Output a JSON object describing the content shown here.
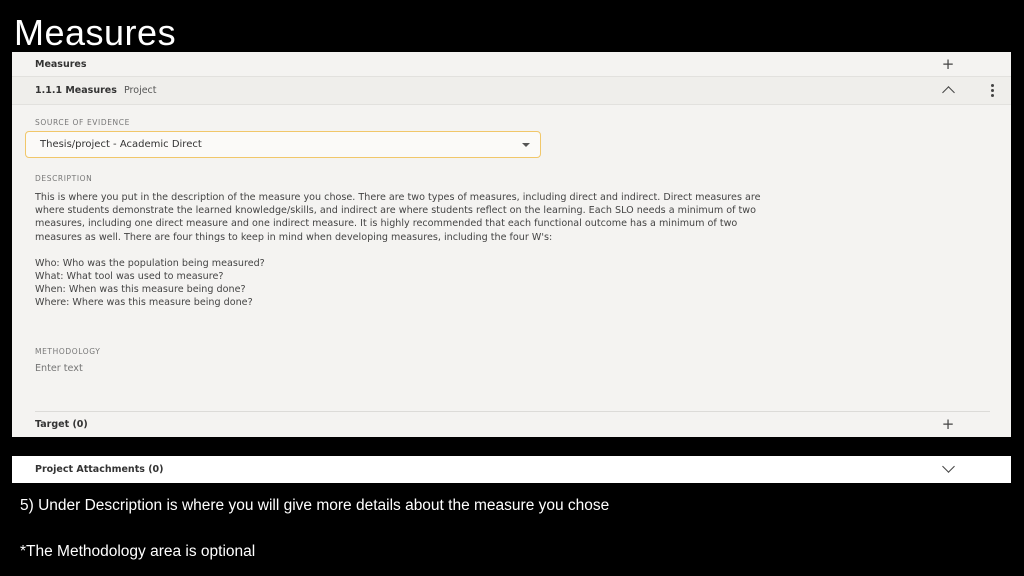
{
  "slide": {
    "title": "Measures",
    "caption1": "5) Under Description is where you will give more details about the measure you chose",
    "caption2": "*The Methodology area is optional"
  },
  "panel": {
    "section_title": "Measures",
    "item_title": "1.1.1 Measures",
    "item_type": "Project",
    "source_label": "SOURCE OF EVIDENCE",
    "source_value": "Thesis/project - Academic Direct",
    "description_label": "DESCRIPTION",
    "description_paragraph": "This is where you put in the description of the measure you chose. There are two types of measures, including direct and indirect. Direct measures are where students demonstrate the learned knowledge/skills, and indirect are where students reflect on the learning. Each SLO needs a minimum of two measures, including one direct measure and one indirect measure. It is highly recommended that each functional outcome has a minimum of two measures as well. There are four things to keep in mind when developing measures, including the four W's:",
    "description_lines": [
      "Who: Who was the population being measured?",
      "What: What tool was used to measure?",
      "When: When was this measure being done?",
      "Where: Where was this measure being done?"
    ],
    "methodology_label": "METHODOLOGY",
    "methodology_placeholder": "Enter text",
    "target_label": "Target (0)",
    "attachments_label": "Project Attachments (0)"
  },
  "icons": {
    "add": "plus-icon",
    "collapse": "chevron-up-icon",
    "more": "kebab-menu-icon",
    "expand": "chevron-down-icon",
    "dropdown": "caret-down-icon"
  },
  "colors": {
    "background": "#000000",
    "panel": "#f4f3f1",
    "select_border": "#f1c76a"
  }
}
